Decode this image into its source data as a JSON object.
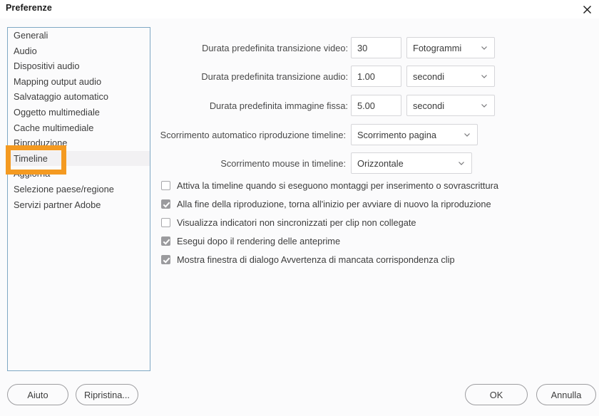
{
  "window": {
    "title": "Preferenze",
    "close_icon": "close-icon"
  },
  "sidebar": {
    "items": [
      {
        "label": "Generali",
        "selected": false
      },
      {
        "label": "Audio",
        "selected": false
      },
      {
        "label": "Dispositivi audio",
        "selected": false
      },
      {
        "label": "Mapping output audio",
        "selected": false
      },
      {
        "label": "Salvataggio automatico",
        "selected": false
      },
      {
        "label": "Oggetto multimediale",
        "selected": false
      },
      {
        "label": "Cache multimediale",
        "selected": false
      },
      {
        "label": "Riproduzione",
        "selected": false
      },
      {
        "label": "Timeline",
        "selected": true
      },
      {
        "label": "Aggiorna",
        "selected": false
      },
      {
        "label": "Selezione paese/regione",
        "selected": false
      },
      {
        "label": "Servizi partner Adobe",
        "selected": false
      }
    ]
  },
  "annotation": {
    "target": "Timeline",
    "color": "#f49a21"
  },
  "form": {
    "rows": [
      {
        "label": "Durata predefinita transizione video:",
        "value": "30",
        "unit": "Fotogrammi"
      },
      {
        "label": "Durata predefinita transizione audio:",
        "value": "1.00",
        "unit": "secondi"
      },
      {
        "label": "Durata predefinita immagine fissa:",
        "value": "5.00",
        "unit": "secondi"
      }
    ],
    "selects": [
      {
        "label": "Scorrimento automatico riproduzione timeline:",
        "value": "Scorrimento pagina"
      },
      {
        "label": "Scorrimento mouse in timeline:",
        "value": "Orizzontale"
      }
    ],
    "checkboxes": [
      {
        "label": "Attiva la timeline quando si eseguono montaggi per inserimento o sovrascrittura",
        "checked": false
      },
      {
        "label": "Alla fine della riproduzione, torna all'inizio per avviare di nuovo la riproduzione",
        "checked": true
      },
      {
        "label": "Visualizza indicatori non sincronizzati per clip non collegate",
        "checked": false
      },
      {
        "label": "Esegui dopo il rendering delle anteprime",
        "checked": true
      },
      {
        "label": "Mostra finestra di dialogo Avvertenza di mancata corrispondenza clip",
        "checked": true
      }
    ]
  },
  "footer": {
    "help_label": "Aiuto",
    "reset_label": "Ripristina...",
    "ok_label": "OK",
    "cancel_label": "Annulla"
  }
}
